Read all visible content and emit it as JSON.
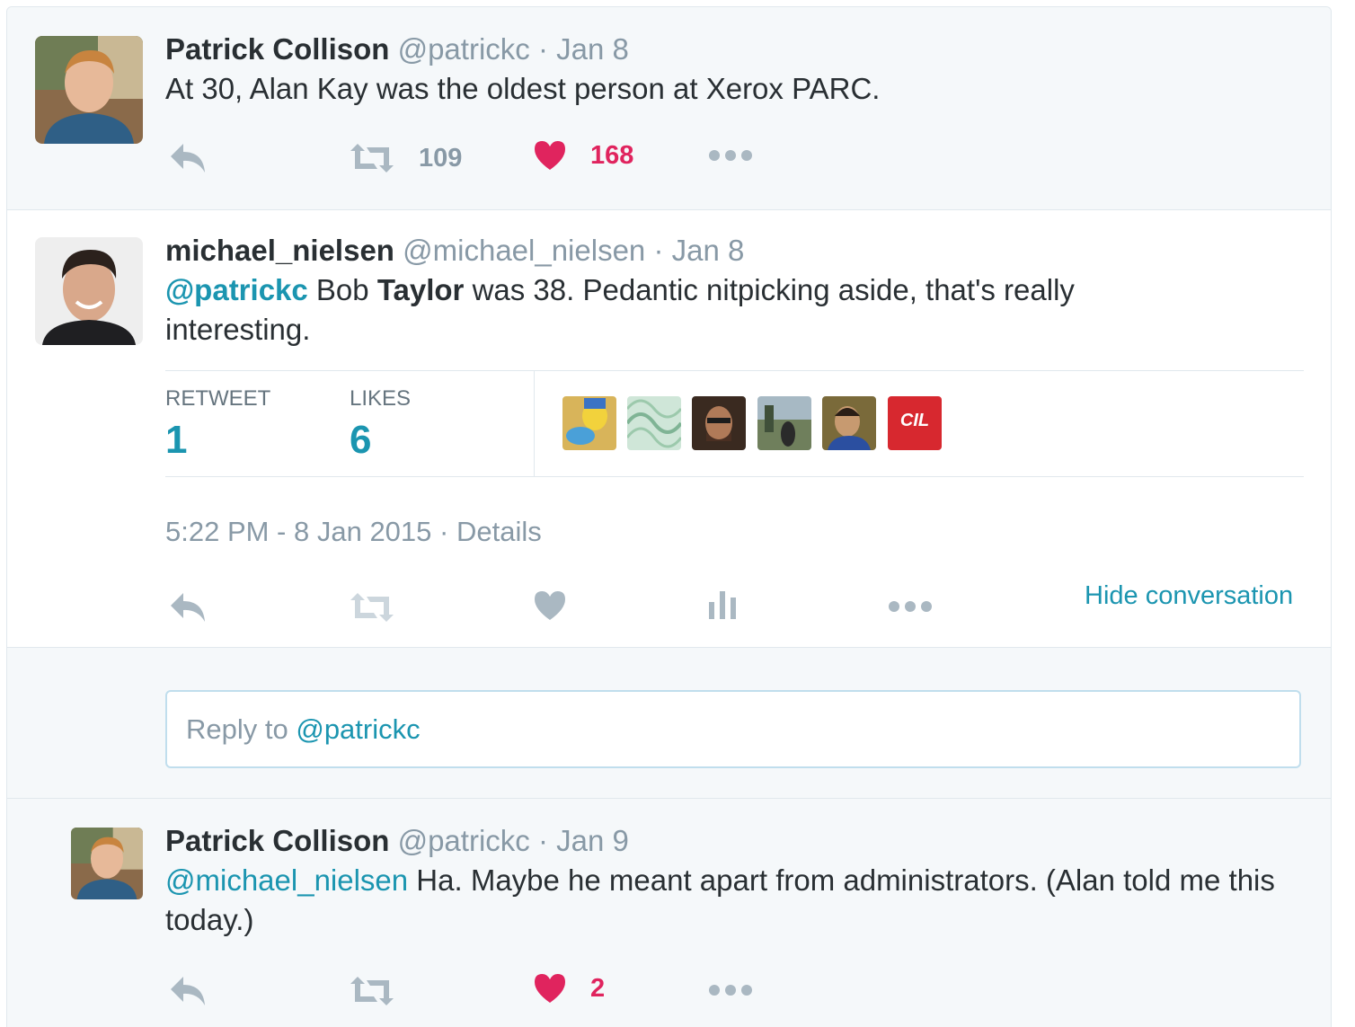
{
  "tweets": [
    {
      "name": "Patrick Collison",
      "handle": "@patrickc",
      "sep": "·",
      "date": "Jan 8",
      "text": "At 30, Alan Kay was the oldest person at Xerox PARC.",
      "retweets": "109",
      "likes": "168",
      "liked": true
    },
    {
      "name": "michael_nielsen",
      "handle": "@michael_nielsen",
      "sep": "·",
      "date": "Jan 8",
      "mention": "@patrickc",
      "text_a": " Bob ",
      "text_bold": "Taylor",
      "text_b": " was 38.  Pedantic nitpicking aside, that's really interesting.",
      "stats": {
        "retweet_label": "RETWEET",
        "retweet_count": "1",
        "likes_label": "LIKES",
        "likes_count": "6",
        "liker_badge": "CIL"
      },
      "timestamp": "5:22 PM - 8 Jan 2015",
      "details": "Details",
      "hide_conversation": "Hide conversation"
    },
    {
      "name": "Patrick Collison",
      "handle": "@patrickc",
      "sep": "·",
      "date": "Jan 9",
      "mention": "@michael_nielsen",
      "text": " Ha. Maybe he meant apart from administrators. (Alan told me this today.)",
      "likes": "2",
      "liked": true
    }
  ],
  "reply": {
    "prefix": "Reply to ",
    "mention": "@patrickc"
  },
  "colors": {
    "link": "#1b95b0",
    "like_red": "#e0245e",
    "muted": "#8899a6",
    "icon_grey": "#aab8c2"
  },
  "icons": [
    "reply-icon",
    "retweet-icon",
    "heart-icon",
    "more-icon",
    "analytics-icon"
  ]
}
